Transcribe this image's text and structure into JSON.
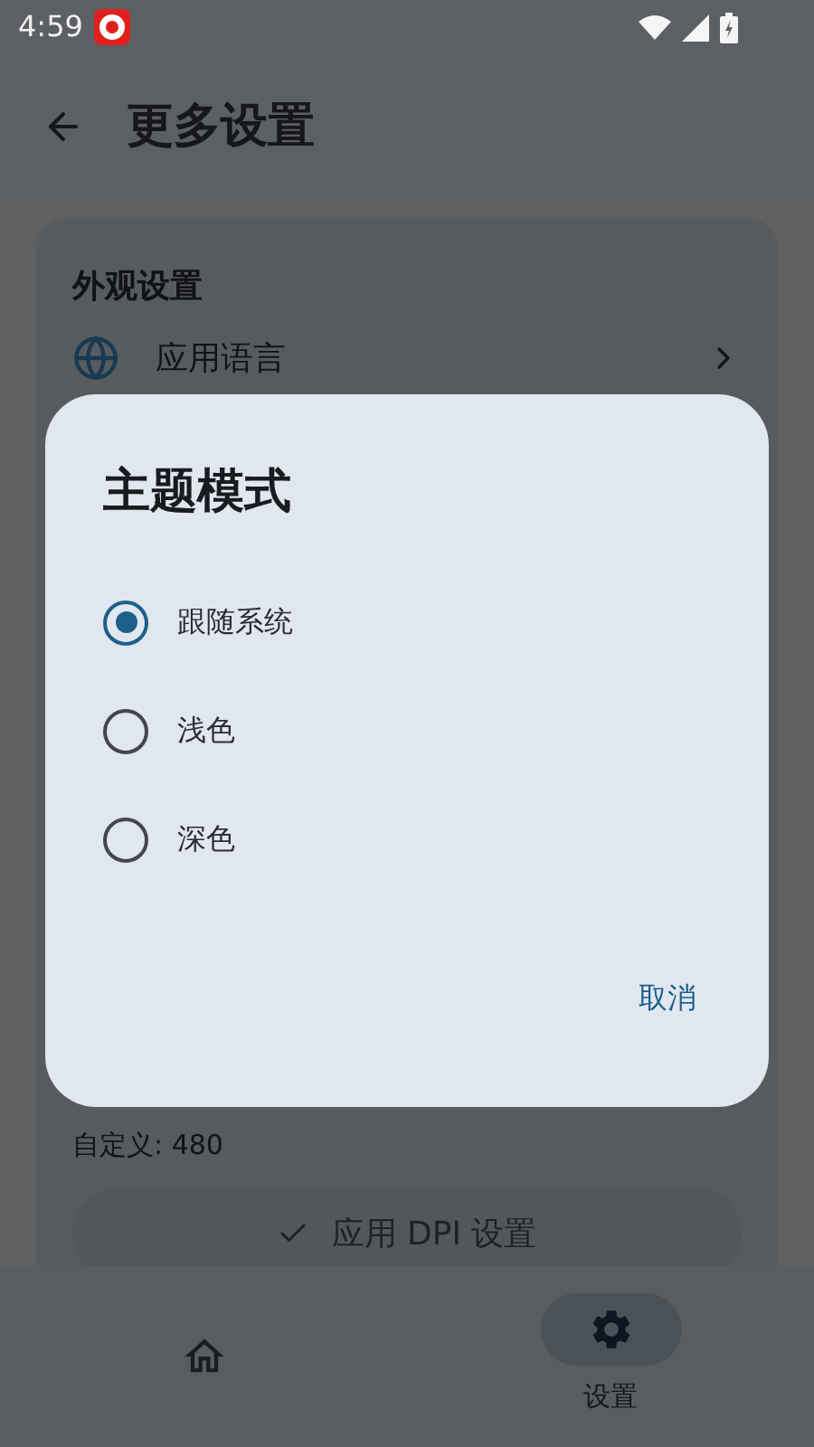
{
  "status_bar": {
    "time": "4:59"
  },
  "top_bar": {
    "title": "更多设置"
  },
  "card": {
    "section_title": "外观设置",
    "language_row": {
      "label": "应用语言"
    },
    "dpi_value": "自定义: 480",
    "apply_button": {
      "label": "应用 DPI 设置",
      "disabled": true
    }
  },
  "dialog": {
    "title": "主题模式",
    "options": [
      {
        "label": "跟随系统",
        "selected": true
      },
      {
        "label": "浅色",
        "selected": false
      },
      {
        "label": "深色",
        "selected": false
      }
    ],
    "cancel": "取消"
  },
  "bottom_nav": [
    {
      "kind": "home",
      "selected": false
    },
    {
      "kind": "settings",
      "label": "设置",
      "selected": true
    }
  ]
}
